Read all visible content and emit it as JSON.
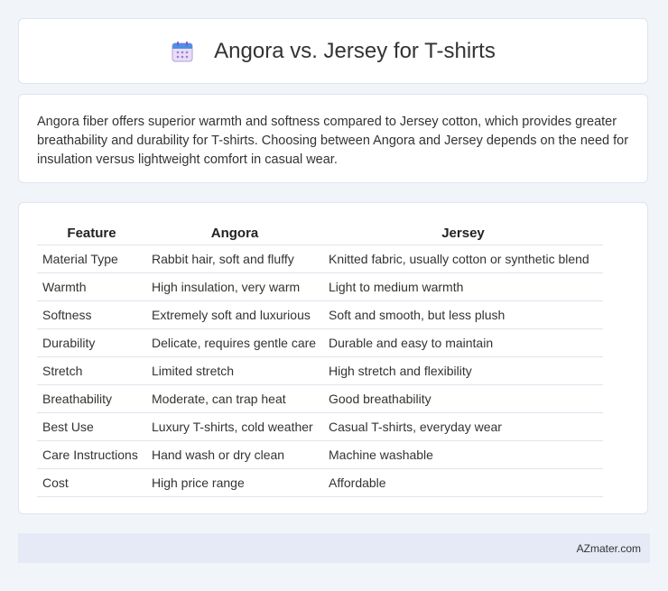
{
  "header": {
    "title": "Angora vs. Jersey for T-shirts",
    "icon": "calendar-icon"
  },
  "intro": {
    "text": "Angora fiber offers superior warmth and softness compared to Jersey cotton, which provides greater breathability and durability for T-shirts. Choosing between Angora and Jersey depends on the need for insulation versus lightweight comfort in casual wear."
  },
  "table": {
    "headers": [
      "Feature",
      "Angora",
      "Jersey"
    ],
    "rows": [
      [
        "Material Type",
        "Rabbit hair, soft and fluffy",
        "Knitted fabric, usually cotton or synthetic blend"
      ],
      [
        "Warmth",
        "High insulation, very warm",
        "Light to medium warmth"
      ],
      [
        "Softness",
        "Extremely soft and luxurious",
        "Soft and smooth, but less plush"
      ],
      [
        "Durability",
        "Delicate, requires gentle care",
        "Durable and easy to maintain"
      ],
      [
        "Stretch",
        "Limited stretch",
        "High stretch and flexibility"
      ],
      [
        "Breathability",
        "Moderate, can trap heat",
        "Good breathability"
      ],
      [
        "Best Use",
        "Luxury T-shirts, cold weather",
        "Casual T-shirts, everyday wear"
      ],
      [
        "Care Instructions",
        "Hand wash or dry clean",
        "Machine washable"
      ],
      [
        "Cost",
        "High price range",
        "Affordable"
      ]
    ]
  },
  "footer": {
    "brand": "AZmater.com"
  }
}
